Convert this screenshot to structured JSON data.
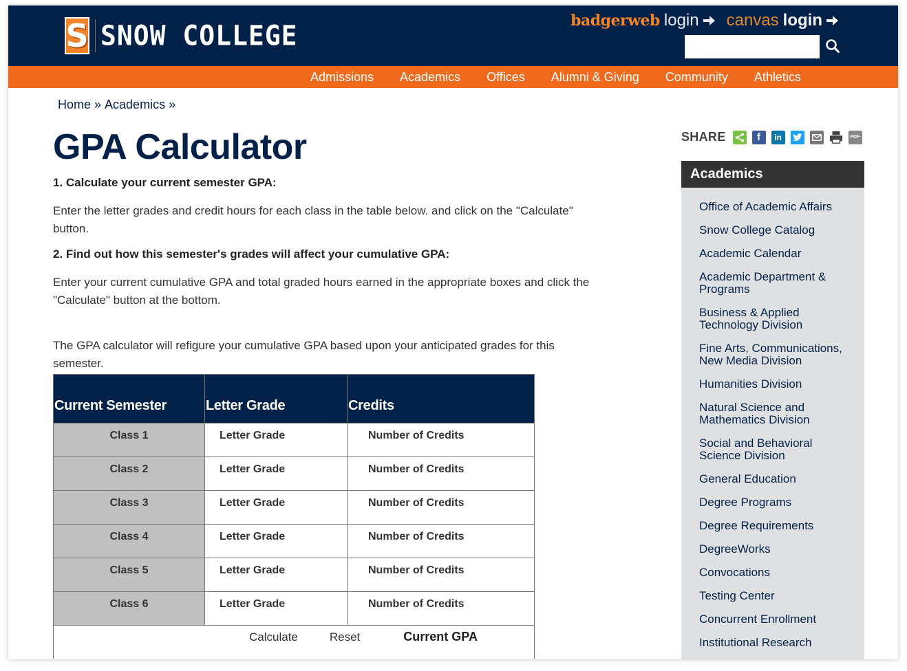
{
  "header": {
    "logo_letter": "S",
    "logo_text": "SNOW COLLEGE",
    "logins": [
      {
        "brand": "badgerweb",
        "word": "login"
      },
      {
        "brand": "canvas",
        "word": "login"
      }
    ],
    "search_placeholder": "",
    "search_value": ""
  },
  "nav": {
    "items": [
      "Admissions",
      "Academics",
      "Offices",
      "Alumni & Giving",
      "Community",
      "Athletics"
    ]
  },
  "breadcrumb": {
    "items": [
      "Home",
      "Academics"
    ],
    "separator": "»"
  },
  "page": {
    "title": "GPA Calculator",
    "step1_heading": "1. Calculate your current semester GPA:",
    "step1_text": "Enter the letter grades and credit hours for each class in the table below. and click on the \"Calculate\" button.",
    "step2_heading": "2. Find out how this semester's grades will affect your cumulative GPA:",
    "step2_text": "Enter your current cumulative GPA and total graded hours earned in the appropriate boxes and click the \"Calculate\" button at the bottom.",
    "note_text": "The GPA calculator will refigure your cumulative GPA based upon your anticipated grades for this semester."
  },
  "table": {
    "headers": [
      "Current Semester",
      "Letter Grade",
      "Credits"
    ],
    "rows": [
      {
        "class": "Class 1",
        "grade": "Letter Grade",
        "credits": "Number of Credits"
      },
      {
        "class": "Class 2",
        "grade": "Letter Grade",
        "credits": "Number of Credits"
      },
      {
        "class": "Class 3",
        "grade": "Letter Grade",
        "credits": "Number of Credits"
      },
      {
        "class": "Class 4",
        "grade": "Letter Grade",
        "credits": "Number of Credits"
      },
      {
        "class": "Class 5",
        "grade": "Letter Grade",
        "credits": "Number of Credits"
      },
      {
        "class": "Class 6",
        "grade": "Letter Grade",
        "credits": "Number of Credits"
      }
    ],
    "calculate_label": "Calculate",
    "reset_label": "Reset",
    "current_gpa_label": "Current GPA"
  },
  "share": {
    "label": "SHARE",
    "icons": [
      "share-icon",
      "facebook-icon",
      "linkedin-icon",
      "twitter-icon",
      "email-icon",
      "print-icon",
      "pdf-icon"
    ],
    "fb_glyph": "f",
    "li_glyph": "in",
    "pdf_glyph": "PDF"
  },
  "sidebar": {
    "title": "Academics",
    "items": [
      "Office of Academic Affairs",
      "Snow College Catalog",
      "Academic Calendar",
      "Academic Department & Programs",
      "Business & Applied Technology Division",
      "Fine Arts, Communications, New Media Division",
      "Humanities Division",
      "Natural Science and Mathematics Division",
      "Social and Behavioral Science Division",
      "General Education",
      "Degree Programs",
      "Degree Requirements",
      "DegreeWorks",
      "Convocations",
      "Testing Center",
      "Concurrent Enrollment",
      "Institutional Research"
    ]
  },
  "colors": {
    "navy": "#022149",
    "orange": "#ef6a1c",
    "sidebar_bg": "#dfe0e1",
    "class_cell_bg": "#c0c0c0"
  }
}
